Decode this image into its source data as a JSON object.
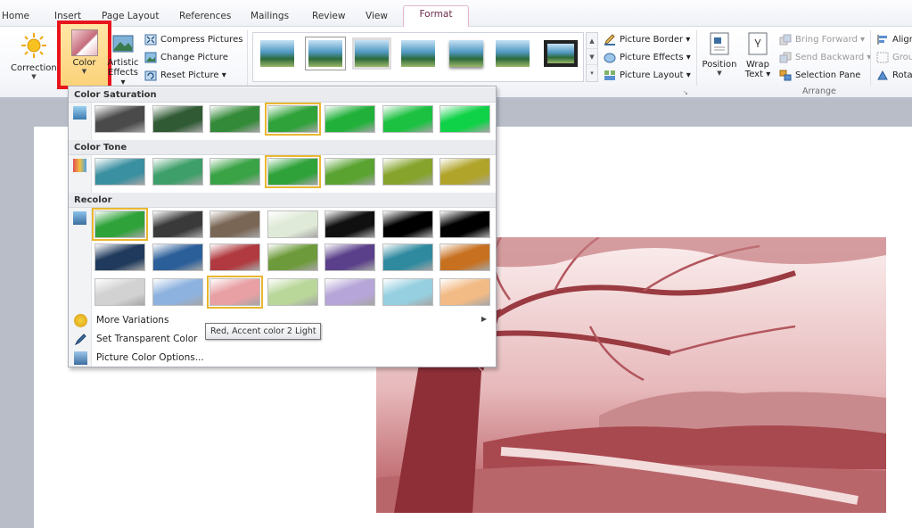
{
  "tabs": [
    "Home",
    "Insert",
    "Page Layout",
    "References",
    "Mailings",
    "Review",
    "View",
    "Format"
  ],
  "active_tab": "Format",
  "ribbon": {
    "corrections_label": "Corrections",
    "color_label": "Color",
    "artistic_effects_line1": "Artistic",
    "artistic_effects_line2": "Effects",
    "compress_pictures": "Compress Pictures",
    "change_picture": "Change Picture",
    "reset_picture": "Reset Picture",
    "picture_border": "Picture Border",
    "picture_effects": "Picture Effects",
    "picture_layout": "Picture Layout",
    "position_label": "Position",
    "wrap_text_line1": "Wrap",
    "wrap_text_line2": "Text",
    "bring_forward": "Bring Forward",
    "send_backward": "Send Backward",
    "selection_pane": "Selection Pane",
    "align": "Align",
    "group": "Group",
    "rotate": "Rotate",
    "arrange_group_label": "Arrange"
  },
  "dropdown": {
    "sections": {
      "saturation": "Color Saturation",
      "tone": "Color Tone",
      "recolor": "Recolor"
    },
    "more_variations": "More Variations",
    "set_transparent": "Set Transparent Color",
    "color_options": "Picture Color Options...",
    "tooltip": "Red, Accent color 2 Light",
    "colors": {
      "saturation": [
        "#4a4a4a",
        "#2f5a33",
        "#338a38",
        "#2fa23a",
        "#21b13a",
        "#1cc141",
        "#10d248"
      ],
      "tone": [
        "#3a8fa0",
        "#3f9f6a",
        "#3aa346",
        "#2fa23a",
        "#5aa331",
        "#86a42c",
        "#b1a42a"
      ],
      "recolor_row1": [
        "#2fa23a",
        "#3a3a3a",
        "#7a6655",
        "#e0ead8",
        "#101010",
        "#000000",
        "#000000"
      ],
      "recolor_row2": [
        "#1f3a5c",
        "#2b5f99",
        "#b03a3f",
        "#6d9a3a",
        "#5a3f8a",
        "#2f8aa0",
        "#c7701f"
      ],
      "recolor_row3": [
        "#d2d2d2",
        "#8eb2df",
        "#e8a0a4",
        "#bad79a",
        "#b6a5d8",
        "#96d0e0",
        "#f2bb86"
      ]
    }
  }
}
